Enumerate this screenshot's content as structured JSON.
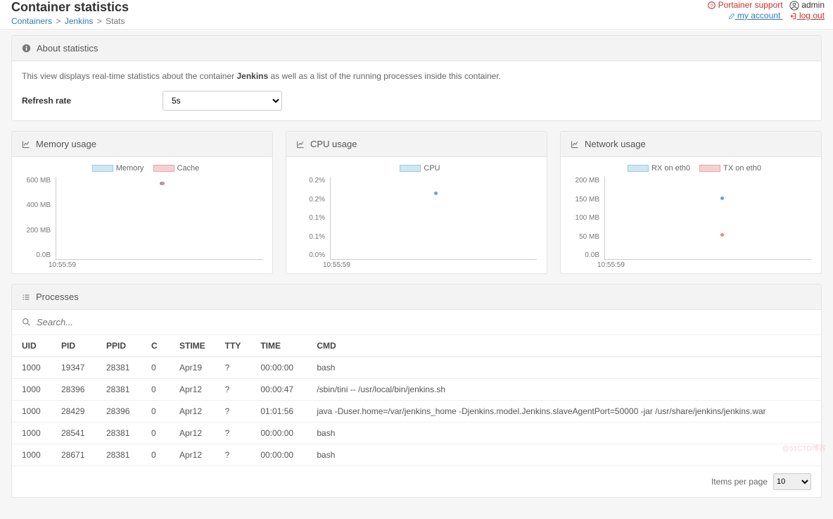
{
  "header": {
    "page_title": "Container statistics",
    "breadcrumb": {
      "containers": "Containers",
      "container": "Jenkins",
      "current": "Stats"
    },
    "support": "Portainer support",
    "user": "admin",
    "my_account": "my account",
    "logout": "log out"
  },
  "about": {
    "title": "About statistics",
    "desc_pre": "This view displays real-time statistics about the container ",
    "desc_bold": "Jenkins",
    "desc_post": " as well as a list of the running processes inside this container.",
    "refresh_label": "Refresh rate",
    "refresh_value": "5s"
  },
  "charts": {
    "memory": {
      "title": "Memory usage",
      "legend_a": "Memory",
      "legend_b": "Cache"
    },
    "cpu": {
      "title": "CPU usage",
      "legend": "CPU"
    },
    "network": {
      "title": "Network usage",
      "legend_a": "RX on eth0",
      "legend_b": "TX on eth0"
    }
  },
  "chart_data": [
    {
      "type": "scatter",
      "title": "Memory usage",
      "series": [
        {
          "name": "Memory",
          "x": [
            "10:55:59"
          ],
          "values": [
            560
          ]
        },
        {
          "name": "Cache",
          "x": [
            "10:55:59"
          ],
          "values": [
            560
          ]
        }
      ],
      "yticks": [
        "600 MB",
        "400 MB",
        "200 MB",
        "0.0B"
      ],
      "ylim": [
        0,
        600
      ],
      "xlabel": "10:55:59"
    },
    {
      "type": "scatter",
      "title": "CPU usage",
      "series": [
        {
          "name": "CPU",
          "x": [
            "10:55:59"
          ],
          "values": [
            0.17
          ]
        }
      ],
      "yticks": [
        "0.2%",
        "0.2%",
        "0.1%",
        "0.1%",
        "0.0%"
      ],
      "ylim": [
        0,
        0.2
      ],
      "xlabel": "10:55:59"
    },
    {
      "type": "scatter",
      "title": "Network usage",
      "series": [
        {
          "name": "RX on eth0",
          "x": [
            "10:55:59"
          ],
          "values": [
            150
          ]
        },
        {
          "name": "TX on eth0",
          "x": [
            "10:55:59"
          ],
          "values": [
            60
          ]
        }
      ],
      "yticks": [
        "200 MB",
        "150 MB",
        "100 MB",
        "50 MB",
        "0.0B"
      ],
      "ylim": [
        0,
        200
      ],
      "xlabel": "10:55:59"
    }
  ],
  "processes": {
    "title": "Processes",
    "search_placeholder": "Search...",
    "headers": {
      "uid": "UID",
      "pid": "PID",
      "ppid": "PPID",
      "c": "C",
      "stime": "STIME",
      "tty": "TTY",
      "time": "TIME",
      "cmd": "CMD"
    },
    "rows": [
      {
        "uid": "1000",
        "pid": "19347",
        "ppid": "28381",
        "c": "0",
        "stime": "Apr19",
        "tty": "?",
        "time": "00:00:00",
        "cmd": "bash"
      },
      {
        "uid": "1000",
        "pid": "28396",
        "ppid": "28381",
        "c": "0",
        "stime": "Apr12",
        "tty": "?",
        "time": "00:00:47",
        "cmd": "/sbin/tini -- /usr/local/bin/jenkins.sh"
      },
      {
        "uid": "1000",
        "pid": "28429",
        "ppid": "28396",
        "c": "0",
        "stime": "Apr12",
        "tty": "?",
        "time": "01:01:56",
        "cmd": "java -Duser.home=/var/jenkins_home -Djenkins.model.Jenkins.slaveAgentPort=50000 -jar /usr/share/jenkins/jenkins.war"
      },
      {
        "uid": "1000",
        "pid": "28541",
        "ppid": "28381",
        "c": "0",
        "stime": "Apr12",
        "tty": "?",
        "time": "00:00:00",
        "cmd": "bash"
      },
      {
        "uid": "1000",
        "pid": "28671",
        "ppid": "28381",
        "c": "0",
        "stime": "Apr12",
        "tty": "?",
        "time": "00:00:00",
        "cmd": "bash"
      }
    ],
    "items_per_page_label": "Items per page",
    "items_per_page_value": "10"
  },
  "watermark": "@51CTO博客"
}
